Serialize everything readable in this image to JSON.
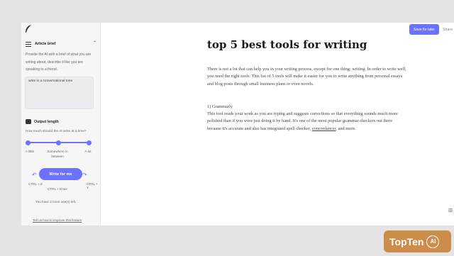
{
  "sidebar": {
    "article_brief_title": "Article brief",
    "article_brief_desc": "Provide the AI with a brief of what you are writing about, describe it like you are speaking to a friend.",
    "brief_value": "write in a conversational tone",
    "output_length_title": "Output length",
    "output_length_question": "How much should the AI write at a time?",
    "slider_labels": [
      "A little",
      "Somewhere in between",
      "A lot"
    ],
    "write_button": "Write for me",
    "shortcut_undo": "CTRL + Z",
    "shortcut_redo": "CTRL + Y",
    "shortcut_write": "CTRL + Enter",
    "remaining_text": "You have 2 more use(s) left.",
    "improve_link": "Tell us how to improve this feature"
  },
  "toolbar": {
    "save_label": "Save for later",
    "share_label": "Share"
  },
  "document": {
    "title": "top 5 best tools for writing",
    "intro": "There is not a lot that can help you in your writing process, except for one thing: writing. In order to write well, you need the right tools. This list of 5 tools will make it easier for you to write anything from personal essays and blog posts through small business plans or even novels.",
    "item1_heading": "1) Grammarly",
    "item1_text_before": "This tool reads your work as you are typing and suggests corrections so that everything sounds much more polished than if you were just doing it by hand. It's one of the most popular grammar checkers out there because it's accurate and also has integrated spell checker, ",
    "item1_link": "concordancer",
    "item1_text_after": ", and more."
  },
  "badge": {
    "brand": "TopTen",
    "ai": "AI"
  },
  "colors": {
    "accent": "#6c72ff",
    "badge": "#cc8c4a"
  },
  "icons": [
    "feather-logo-icon",
    "list-icon",
    "chevron-up-icon",
    "robot-icon",
    "undo-icon",
    "redo-icon",
    "pin-icon",
    "menu-icon"
  ]
}
